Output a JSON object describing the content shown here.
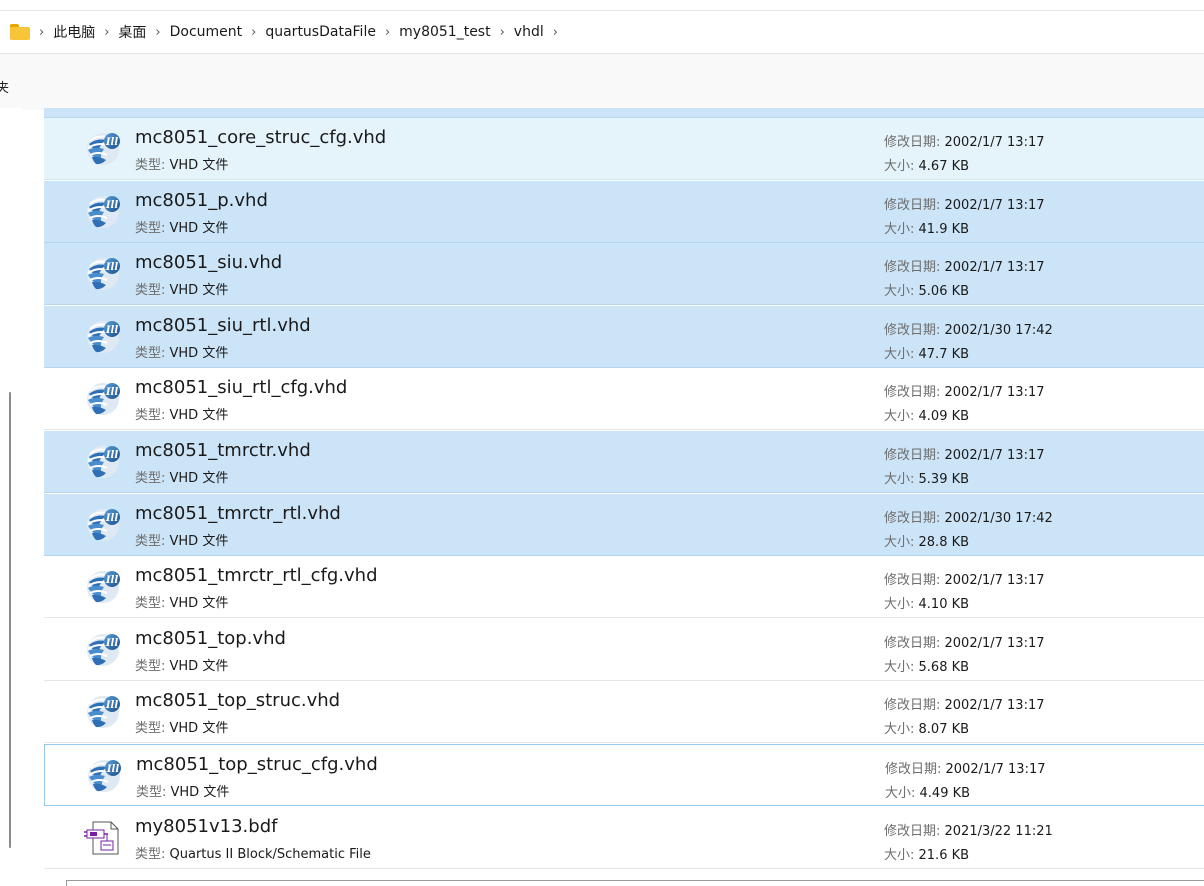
{
  "breadcrumb": {
    "items": [
      "此电脑",
      "桌面",
      "Document",
      "quartusDataFile",
      "my8051_test",
      "vhdl"
    ],
    "separator": "›"
  },
  "toolbar": {
    "cut_label": "夹"
  },
  "labels": {
    "type": "类型: ",
    "modified": "修改日期: ",
    "size": "大小: "
  },
  "colors": {
    "selected": "#cce4f7",
    "hover": "#e5f3fb",
    "folder": "#f7c43a"
  },
  "files": [
    {
      "name": "mc8051_core_struc_cfg.vhd",
      "type": "VHD 文件",
      "modified": "2002/1/7 13:17",
      "size": "4.67 KB",
      "icon": "quartus-vhd-icon",
      "state": "hover"
    },
    {
      "name": "mc8051_p.vhd",
      "type": "VHD 文件",
      "modified": "2002/1/7 13:17",
      "size": "41.9 KB",
      "icon": "quartus-vhd-icon",
      "state": "selected"
    },
    {
      "name": "mc8051_siu.vhd",
      "type": "VHD 文件",
      "modified": "2002/1/7 13:17",
      "size": "5.06 KB",
      "icon": "quartus-vhd-icon",
      "state": "selected"
    },
    {
      "name": "mc8051_siu_rtl.vhd",
      "type": "VHD 文件",
      "modified": "2002/1/30 17:42",
      "size": "47.7 KB",
      "icon": "quartus-vhd-icon",
      "state": "selected"
    },
    {
      "name": "mc8051_siu_rtl_cfg.vhd",
      "type": "VHD 文件",
      "modified": "2002/1/7 13:17",
      "size": "4.09 KB",
      "icon": "quartus-vhd-icon",
      "state": "normal"
    },
    {
      "name": "mc8051_tmrctr.vhd",
      "type": "VHD 文件",
      "modified": "2002/1/7 13:17",
      "size": "5.39 KB",
      "icon": "quartus-vhd-icon",
      "state": "selected"
    },
    {
      "name": "mc8051_tmrctr_rtl.vhd",
      "type": "VHD 文件",
      "modified": "2002/1/30 17:42",
      "size": "28.8 KB",
      "icon": "quartus-vhd-icon",
      "state": "selected"
    },
    {
      "name": "mc8051_tmrctr_rtl_cfg.vhd",
      "type": "VHD 文件",
      "modified": "2002/1/7 13:17",
      "size": "4.10 KB",
      "icon": "quartus-vhd-icon",
      "state": "normal"
    },
    {
      "name": "mc8051_top.vhd",
      "type": "VHD 文件",
      "modified": "2002/1/7 13:17",
      "size": "5.68 KB",
      "icon": "quartus-vhd-icon",
      "state": "normal"
    },
    {
      "name": "mc8051_top_struc.vhd",
      "type": "VHD 文件",
      "modified": "2002/1/7 13:17",
      "size": "8.07 KB",
      "icon": "quartus-vhd-icon",
      "state": "normal"
    },
    {
      "name": "mc8051_top_struc_cfg.vhd",
      "type": "VHD 文件",
      "modified": "2002/1/7 13:17",
      "size": "4.49 KB",
      "icon": "quartus-vhd-icon",
      "state": "focus"
    },
    {
      "name": "my8051v13.bdf",
      "type": "Quartus II Block/Schematic File",
      "modified": "2021/3/22 11:21",
      "size": "21.6 KB",
      "icon": "schematic-file-icon",
      "state": "normal"
    }
  ]
}
